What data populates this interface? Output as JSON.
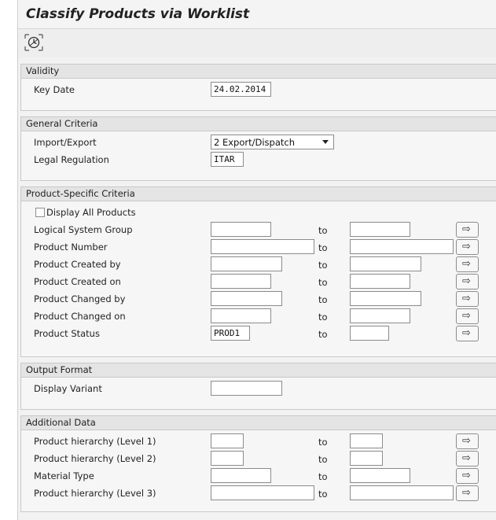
{
  "title": "Classify Products via Worklist",
  "toolbar": {
    "execute_icon": "execute-icon"
  },
  "validity": {
    "header": "Validity",
    "key_date_label": "Key Date",
    "key_date_value": "24.02.2014"
  },
  "general": {
    "header": "General Criteria",
    "import_export_label": "Import/Export",
    "import_export_value": "2 Export/Dispatch",
    "legal_regulation_label": "Legal Regulation",
    "legal_regulation_value": "ITAR"
  },
  "product": {
    "header": "Product-Specific Criteria",
    "display_all_label": "Display All Products",
    "to_label": "to",
    "rows": [
      {
        "label": "Logical System Group",
        "from": "",
        "to": ""
      },
      {
        "label": "Product Number",
        "from": "",
        "to": ""
      },
      {
        "label": "Product Created by",
        "from": "",
        "to": ""
      },
      {
        "label": "Product Created on",
        "from": "",
        "to": ""
      },
      {
        "label": "Product Changed by",
        "from": "",
        "to": ""
      },
      {
        "label": "Product Changed on",
        "from": "",
        "to": ""
      },
      {
        "label": "Product Status",
        "from": "PROD1",
        "to": ""
      }
    ]
  },
  "output": {
    "header": "Output Format",
    "display_variant_label": "Display Variant",
    "display_variant_value": ""
  },
  "additional": {
    "header": "Additional Data",
    "to_label": "to",
    "rows": [
      {
        "label": "Product hierarchy (Level 1)",
        "from": "",
        "to": ""
      },
      {
        "label": "Product hierarchy (Level 2)",
        "from": "",
        "to": ""
      },
      {
        "label": "Material Type",
        "from": "",
        "to": ""
      },
      {
        "label": "Product hierarchy (Level 3)",
        "from": "",
        "to": ""
      }
    ]
  },
  "multiple_selection_glyph": "⇨"
}
